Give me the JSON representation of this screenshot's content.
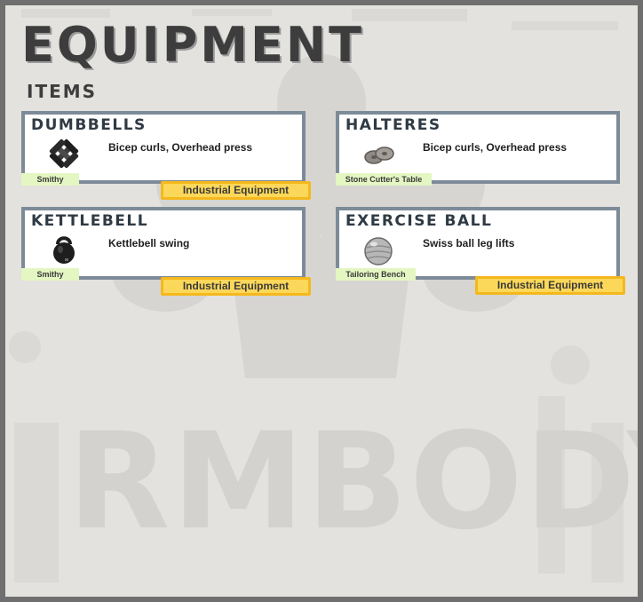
{
  "page": {
    "title": "EQUIPMENT",
    "subtitle": "ITEMS",
    "watermark": "RMBODY"
  },
  "items": [
    {
      "name": "DUMBBELLS",
      "icon": "dumbbell-icon",
      "description": "Bicep curls, Overhead press",
      "station": "Smithy",
      "badge": "Industrial Equipment"
    },
    {
      "name": "HALTERES",
      "icon": "halteres-icon",
      "description": "Bicep curls, Overhead press",
      "station": "Stone Cutter's Table"
    },
    {
      "name": "KETTLEBELL",
      "icon": "kettlebell-icon",
      "description": "Kettlebell swing",
      "station": "Smithy",
      "badge": "Industrial Equipment"
    },
    {
      "name": "EXERCISE BALL",
      "icon": "exercise-ball-icon",
      "description": "Swiss ball leg lifts",
      "station": "Tailoring Bench",
      "badge": "Industrial Equipment"
    }
  ],
  "colors": {
    "background": "#e3e2de",
    "frame": "#6f6f6f",
    "card_border": "#7d8b99",
    "station_tag": "#e4f6c2",
    "badge_fill": "#fcd85a",
    "badge_border": "#f5b81c"
  }
}
